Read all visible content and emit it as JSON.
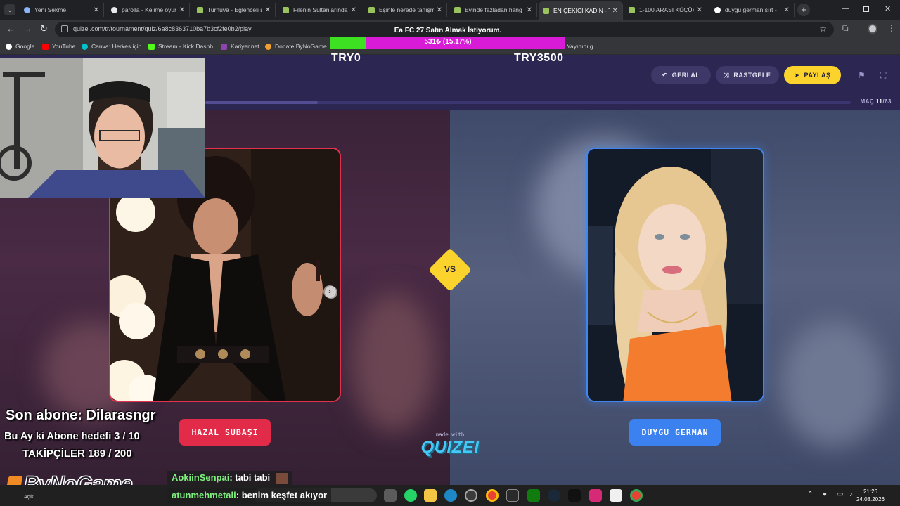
{
  "browser": {
    "tabs": [
      {
        "title": "Yeni Sekme",
        "active": false
      },
      {
        "title": "parolla - Kelime oyun",
        "active": false
      },
      {
        "title": "Turnuva - Eğlenceli s",
        "active": false
      },
      {
        "title": "Filenin Sultanlarında",
        "active": false
      },
      {
        "title": "Eşinle nerede tanışma",
        "active": false
      },
      {
        "title": "Evinde fazladan hang",
        "active": false
      },
      {
        "title": "EN ÇEKİCİ KADIN - T",
        "active": true
      },
      {
        "title": "1-100 ARASI KÜÇÜK",
        "active": false
      },
      {
        "title": "duygu german sırt -",
        "active": false
      }
    ],
    "url": "quizei.com/tr/tournament/quiz/6a8c8363710ba7b3cf2fe0b2/play",
    "bookmarks": [
      "Google",
      "YouTube",
      "Canva: Herkes için...",
      "Stream - Kick Dashb...",
      "Kariyer.net",
      "Donate ByNoGame..."
    ],
    "bookmark_overflow": "Yayınını g..."
  },
  "donation_goal": {
    "title": "Ea FC 27 Satın Almak İstiyorum.",
    "progress_text": "531₺ (15.17%)",
    "fraction": 0.1517,
    "start_label": "TRY0",
    "end_label": "TRY3500"
  },
  "quiz": {
    "back_label": "GERİ AL",
    "random_label": "RASTGELE",
    "share_label": "PAYLAŞ",
    "match_label": "MAÇ",
    "match_current": "11",
    "match_total": "/63",
    "match_fraction": 0.1746,
    "vs_label": "VS",
    "left_name": "HAZAL SUBAŞI",
    "right_name": "DUYGU GERMAN",
    "made_with": "made with",
    "brand": "QUIZEI",
    "colors": {
      "left": "#e3324f",
      "right": "#3f86f0",
      "accent": "#fcd32c"
    }
  },
  "stream": {
    "last_sub": "Son abone: Dilarasngr",
    "sub_goal": "Bu Ay ki Abone hedefi 3 / 10",
    "followers": "TAKİPÇİLER 189 / 200",
    "channel": "ByNoGame",
    "chat": [
      {
        "user": "AokiinSenpai",
        "message": ": tabi tabi"
      },
      {
        "user": "atunmehmetali",
        "message": ": benim keşfet akıyor"
      }
    ]
  },
  "taskbar": {
    "time": "21:26",
    "date": "24.08.2026",
    "weather_label": "Açık"
  }
}
